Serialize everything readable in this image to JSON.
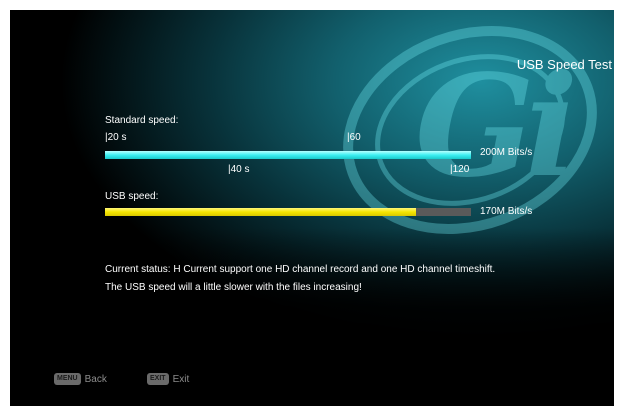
{
  "page": {
    "title": "USB Speed Test"
  },
  "standard": {
    "label": "Standard speed:",
    "ticks": [
      "|20 s",
      "|60",
      "|40 s",
      "|120"
    ],
    "value_text": "200M Bits/s",
    "level": 1.0
  },
  "usb": {
    "label": "USB speed:",
    "value_text": "170M Bits/s",
    "level": 0.85
  },
  "status": {
    "line1": "Current status: H Current support one HD channel record and one HD channel timeshift.",
    "line2": "The USB speed will a little slower with the files increasing!"
  },
  "footer": {
    "menu_key": "MENU",
    "back_label": "Back",
    "exit_key": "EXIT",
    "exit_label": "Exit"
  },
  "colors": {
    "standard_bar": "#3ef0f2",
    "usb_bar": "#f5e600",
    "track": "#5a5a5a"
  },
  "icons": [
    "gi-logo-watermark"
  ]
}
